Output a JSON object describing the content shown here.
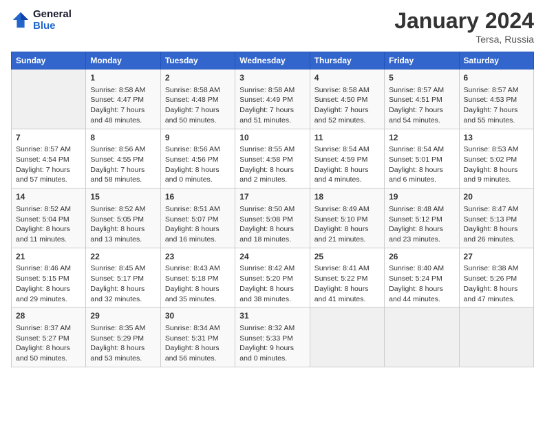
{
  "header": {
    "logo_line1": "General",
    "logo_line2": "Blue",
    "title": "January 2024",
    "subtitle": "Tersa, Russia"
  },
  "days_of_week": [
    "Sunday",
    "Monday",
    "Tuesday",
    "Wednesday",
    "Thursday",
    "Friday",
    "Saturday"
  ],
  "weeks": [
    [
      {
        "day": "",
        "info": ""
      },
      {
        "day": "1",
        "info": "Sunrise: 8:58 AM\nSunset: 4:47 PM\nDaylight: 7 hours\nand 48 minutes."
      },
      {
        "day": "2",
        "info": "Sunrise: 8:58 AM\nSunset: 4:48 PM\nDaylight: 7 hours\nand 50 minutes."
      },
      {
        "day": "3",
        "info": "Sunrise: 8:58 AM\nSunset: 4:49 PM\nDaylight: 7 hours\nand 51 minutes."
      },
      {
        "day": "4",
        "info": "Sunrise: 8:58 AM\nSunset: 4:50 PM\nDaylight: 7 hours\nand 52 minutes."
      },
      {
        "day": "5",
        "info": "Sunrise: 8:57 AM\nSunset: 4:51 PM\nDaylight: 7 hours\nand 54 minutes."
      },
      {
        "day": "6",
        "info": "Sunrise: 8:57 AM\nSunset: 4:53 PM\nDaylight: 7 hours\nand 55 minutes."
      }
    ],
    [
      {
        "day": "7",
        "info": "Sunrise: 8:57 AM\nSunset: 4:54 PM\nDaylight: 7 hours\nand 57 minutes."
      },
      {
        "day": "8",
        "info": "Sunrise: 8:56 AM\nSunset: 4:55 PM\nDaylight: 7 hours\nand 58 minutes."
      },
      {
        "day": "9",
        "info": "Sunrise: 8:56 AM\nSunset: 4:56 PM\nDaylight: 8 hours\nand 0 minutes."
      },
      {
        "day": "10",
        "info": "Sunrise: 8:55 AM\nSunset: 4:58 PM\nDaylight: 8 hours\nand 2 minutes."
      },
      {
        "day": "11",
        "info": "Sunrise: 8:54 AM\nSunset: 4:59 PM\nDaylight: 8 hours\nand 4 minutes."
      },
      {
        "day": "12",
        "info": "Sunrise: 8:54 AM\nSunset: 5:01 PM\nDaylight: 8 hours\nand 6 minutes."
      },
      {
        "day": "13",
        "info": "Sunrise: 8:53 AM\nSunset: 5:02 PM\nDaylight: 8 hours\nand 9 minutes."
      }
    ],
    [
      {
        "day": "14",
        "info": "Sunrise: 8:52 AM\nSunset: 5:04 PM\nDaylight: 8 hours\nand 11 minutes."
      },
      {
        "day": "15",
        "info": "Sunrise: 8:52 AM\nSunset: 5:05 PM\nDaylight: 8 hours\nand 13 minutes."
      },
      {
        "day": "16",
        "info": "Sunrise: 8:51 AM\nSunset: 5:07 PM\nDaylight: 8 hours\nand 16 minutes."
      },
      {
        "day": "17",
        "info": "Sunrise: 8:50 AM\nSunset: 5:08 PM\nDaylight: 8 hours\nand 18 minutes."
      },
      {
        "day": "18",
        "info": "Sunrise: 8:49 AM\nSunset: 5:10 PM\nDaylight: 8 hours\nand 21 minutes."
      },
      {
        "day": "19",
        "info": "Sunrise: 8:48 AM\nSunset: 5:12 PM\nDaylight: 8 hours\nand 23 minutes."
      },
      {
        "day": "20",
        "info": "Sunrise: 8:47 AM\nSunset: 5:13 PM\nDaylight: 8 hours\nand 26 minutes."
      }
    ],
    [
      {
        "day": "21",
        "info": "Sunrise: 8:46 AM\nSunset: 5:15 PM\nDaylight: 8 hours\nand 29 minutes."
      },
      {
        "day": "22",
        "info": "Sunrise: 8:45 AM\nSunset: 5:17 PM\nDaylight: 8 hours\nand 32 minutes."
      },
      {
        "day": "23",
        "info": "Sunrise: 8:43 AM\nSunset: 5:18 PM\nDaylight: 8 hours\nand 35 minutes."
      },
      {
        "day": "24",
        "info": "Sunrise: 8:42 AM\nSunset: 5:20 PM\nDaylight: 8 hours\nand 38 minutes."
      },
      {
        "day": "25",
        "info": "Sunrise: 8:41 AM\nSunset: 5:22 PM\nDaylight: 8 hours\nand 41 minutes."
      },
      {
        "day": "26",
        "info": "Sunrise: 8:40 AM\nSunset: 5:24 PM\nDaylight: 8 hours\nand 44 minutes."
      },
      {
        "day": "27",
        "info": "Sunrise: 8:38 AM\nSunset: 5:26 PM\nDaylight: 8 hours\nand 47 minutes."
      }
    ],
    [
      {
        "day": "28",
        "info": "Sunrise: 8:37 AM\nSunset: 5:27 PM\nDaylight: 8 hours\nand 50 minutes."
      },
      {
        "day": "29",
        "info": "Sunrise: 8:35 AM\nSunset: 5:29 PM\nDaylight: 8 hours\nand 53 minutes."
      },
      {
        "day": "30",
        "info": "Sunrise: 8:34 AM\nSunset: 5:31 PM\nDaylight: 8 hours\nand 56 minutes."
      },
      {
        "day": "31",
        "info": "Sunrise: 8:32 AM\nSunset: 5:33 PM\nDaylight: 9 hours\nand 0 minutes."
      },
      {
        "day": "",
        "info": ""
      },
      {
        "day": "",
        "info": ""
      },
      {
        "day": "",
        "info": ""
      }
    ]
  ]
}
